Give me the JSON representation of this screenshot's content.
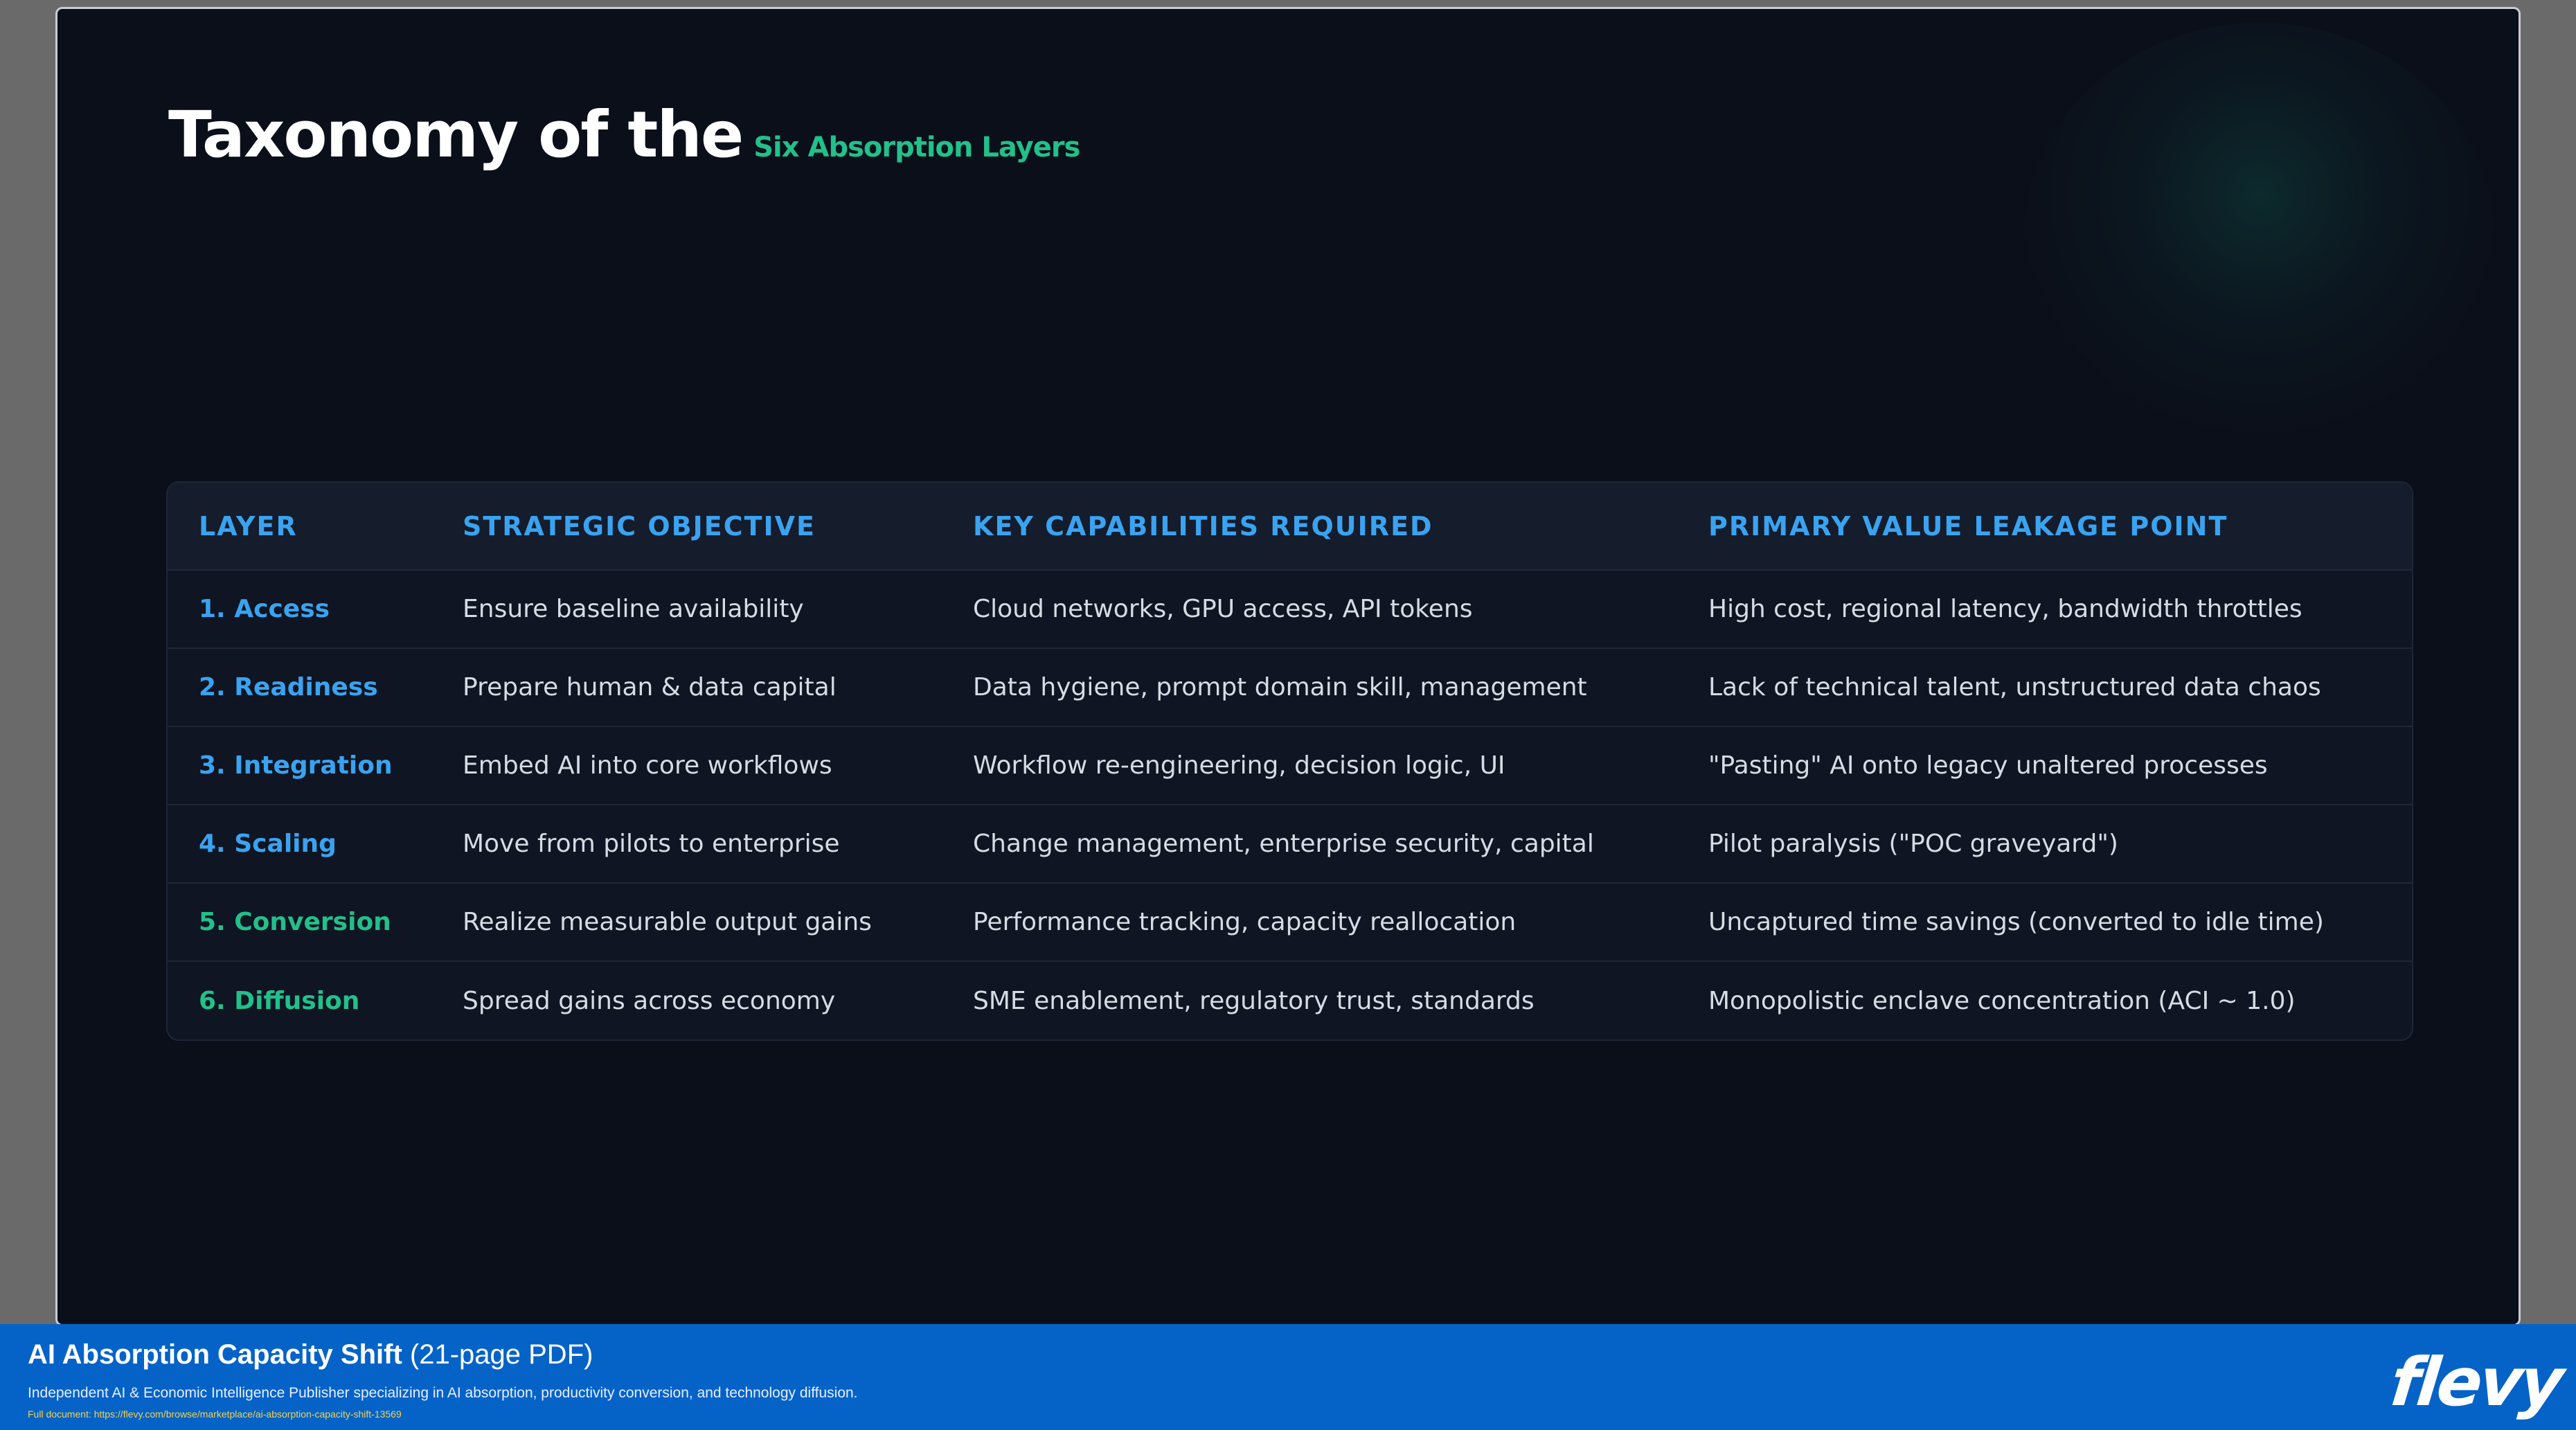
{
  "slide": {
    "title_main": "Taxonomy of the",
    "title_accent": "Six Absorption Layers"
  },
  "table": {
    "headers": [
      "LAYER",
      "STRATEGIC OBJECTIVE",
      "KEY CAPABILITIES REQUIRED",
      "PRIMARY VALUE LEAKAGE POINT"
    ],
    "rows": [
      {
        "layer": "1. Access",
        "objective": "Ensure baseline availability",
        "capabilities": "Cloud networks, GPU access, API tokens",
        "leakage": "High cost, regional latency, bandwidth throttles"
      },
      {
        "layer": "2. Readiness",
        "objective": "Prepare human & data capital",
        "capabilities": "Data hygiene, prompt domain skill, management",
        "leakage": "Lack of technical talent, unstructured data chaos"
      },
      {
        "layer": "3. Integration",
        "objective": "Embed AI into core workflows",
        "capabilities": "Workflow re-engineering, decision logic, UI",
        "leakage": "\"Pasting\" AI onto legacy unaltered processes"
      },
      {
        "layer": "4. Scaling",
        "objective": "Move from pilots to enterprise",
        "capabilities": "Change management, enterprise security, capital",
        "leakage": "Pilot paralysis (\"POC graveyard\")"
      },
      {
        "layer": "5. Conversion",
        "objective": "Realize measurable output gains",
        "capabilities": "Performance tracking, capacity reallocation",
        "leakage": "Uncaptured time savings (converted to idle time)"
      },
      {
        "layer": "6. Diffusion",
        "objective": "Spread gains across economy",
        "capabilities": "SME enablement, regulatory trust, standards",
        "leakage": "Monopolistic enclave concentration (ACI ~ 1.0)"
      }
    ]
  },
  "banner": {
    "title": "AI Absorption Capacity Shift",
    "pages": "(21-page PDF)",
    "description": "Independent AI & Economic Intelligence Publisher specializing in AI absorption, productivity conversion, and technology diffusion.",
    "link": "Full document: https://flevy.com/browse/marketplace/ai-absorption-capacity-shift-13569",
    "logo": "flevy"
  },
  "colors": {
    "slide_bg": "#0b0f19",
    "accent_blue": "#3aa3f0",
    "accent_green": "#22c08a",
    "banner_bg": "#0563c8",
    "link_yellow": "#f5d24a"
  }
}
